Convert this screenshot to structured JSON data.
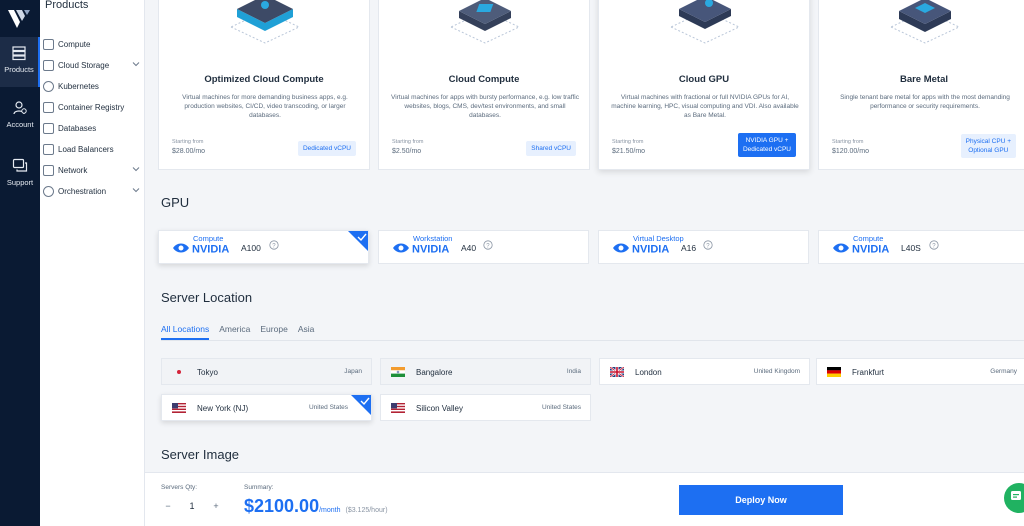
{
  "rail": {
    "items": [
      {
        "label": "Products",
        "icon": "server-stack-icon"
      },
      {
        "label": "Account",
        "icon": "account-icon"
      },
      {
        "label": "Support",
        "icon": "chat-support-icon"
      }
    ]
  },
  "sidebar": {
    "title": "Products",
    "items": [
      {
        "label": "Compute",
        "has_chevron": false
      },
      {
        "label": "Cloud Storage",
        "has_chevron": true
      },
      {
        "label": "Kubernetes",
        "has_chevron": false
      },
      {
        "label": "Container Registry",
        "has_chevron": false
      },
      {
        "label": "Databases",
        "has_chevron": false
      },
      {
        "label": "Load Balancers",
        "has_chevron": false
      },
      {
        "label": "Network",
        "has_chevron": true
      },
      {
        "label": "Orchestration",
        "has_chevron": true
      }
    ]
  },
  "types": [
    {
      "title": "Optimized Cloud Compute",
      "desc": "Virtual machines for more demanding business apps, e.g. production websites, CI/CD, video transcoding, or larger databases.",
      "starting": "Starting from",
      "price": "$28.00/mo",
      "badge": "Dedicated vCPU"
    },
    {
      "title": "Cloud Compute",
      "desc": "Virtual machines for apps with bursty performance, e.g. low traffic websites, blogs, CMS, dev/test environments, and small databases.",
      "starting": "Starting from",
      "price": "$2.50/mo",
      "badge": "Shared vCPU"
    },
    {
      "title": "Cloud GPU",
      "desc": "Virtual machines with fractional or full NVIDIA GPUs for AI, machine learning, HPC, visual computing and VDI. Also available as Bare Metal.",
      "starting": "Starting from",
      "price": "$21.50/mo",
      "badge_line1": "NVIDIA GPU +",
      "badge_line2": "Dedicated vCPU"
    },
    {
      "title": "Bare Metal",
      "desc": "Single tenant bare metal for apps with the most demanding performance or security requirements.",
      "starting": "Starting from",
      "price": "$120.00/mo",
      "badge_line1": "Physical CPU +",
      "badge_line2": "Optional GPU"
    }
  ],
  "gpu": {
    "title": "GPU",
    "brand": "NVIDIA",
    "cards": [
      {
        "category": "Compute",
        "model": "A100"
      },
      {
        "category": "Workstation",
        "model": "A40"
      },
      {
        "category": "Virtual Desktop",
        "model": "A16"
      },
      {
        "category": "Compute",
        "model": "L40S"
      }
    ]
  },
  "location": {
    "title": "Server Location",
    "tabs": [
      "All Locations",
      "America",
      "Europe",
      "Asia"
    ],
    "cities": [
      {
        "city": "Tokyo",
        "country": "Japan",
        "flag": "japan-flag-icon"
      },
      {
        "city": "Bangalore",
        "country": "India",
        "flag": "india-flag-icon"
      },
      {
        "city": "London",
        "country": "United Kingdom",
        "flag": "uk-flag-icon"
      },
      {
        "city": "Frankfurt",
        "country": "Germany",
        "flag": "germany-flag-icon"
      },
      {
        "city": "New York (NJ)",
        "country": "United States",
        "flag": "us-flag-icon"
      },
      {
        "city": "Silicon Valley",
        "country": "United States",
        "flag": "us-flag-icon"
      }
    ]
  },
  "image_section": {
    "title": "Server Image"
  },
  "bottom": {
    "qty_label": "Servers Qty:",
    "minus": "−",
    "qty": "1",
    "plus": "+",
    "summary_label": "Summary:",
    "price": "$2100.00",
    "per": "/month",
    "hourly": "($3.125/hour)",
    "deploy": "Deploy Now"
  },
  "colors": {
    "accent": "#1d6ff2",
    "rail": "#0a1a33",
    "chat": "#20b261"
  }
}
